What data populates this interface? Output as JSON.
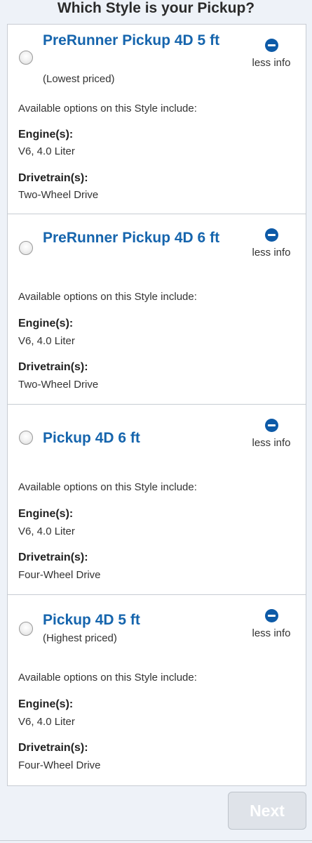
{
  "page": {
    "title": "Which Style is your Pickup?"
  },
  "styles": [
    {
      "name": "PreRunner Pickup 4D 5 ft",
      "note": "(Lowest priced)",
      "less_info": "less info",
      "options_intro": "Available options on this Style include:",
      "engine_label": "Engine(s):",
      "engine": "V6, 4.0 Liter",
      "drivetrain_label": "Drivetrain(s):",
      "drivetrain": "Two-Wheel Drive",
      "selected": false
    },
    {
      "name": "PreRunner Pickup 4D 6 ft",
      "note": "",
      "less_info": "less info",
      "options_intro": "Available options on this Style include:",
      "engine_label": "Engine(s):",
      "engine": "V6, 4.0 Liter",
      "drivetrain_label": "Drivetrain(s):",
      "drivetrain": "Two-Wheel Drive",
      "selected": false
    },
    {
      "name": "Pickup 4D 6 ft",
      "note": "",
      "less_info": "less info",
      "options_intro": "Available options on this Style include:",
      "engine_label": "Engine(s):",
      "engine": "V6, 4.0 Liter",
      "drivetrain_label": "Drivetrain(s):",
      "drivetrain": "Four-Wheel Drive",
      "selected": false
    },
    {
      "name": "Pickup 4D 5 ft",
      "note": "(Highest priced)",
      "less_info": "less info",
      "options_intro": "Available options on this Style include:",
      "engine_label": "Engine(s):",
      "engine": "V6, 4.0 Liter",
      "drivetrain_label": "Drivetrain(s):",
      "drivetrain": "Four-Wheel Drive",
      "selected": false
    }
  ],
  "footer": {
    "next_label": "Next",
    "next_enabled": false
  },
  "colors": {
    "title_blue": "#1665ad",
    "icon_blue": "#0d5aa7",
    "background": "#eef2f8",
    "border": "#c7ccd3",
    "disabled_button": "#dfe3e9"
  },
  "icons": {
    "radio": "radio-unchecked-icon",
    "less_info": "minus-circle-icon"
  }
}
